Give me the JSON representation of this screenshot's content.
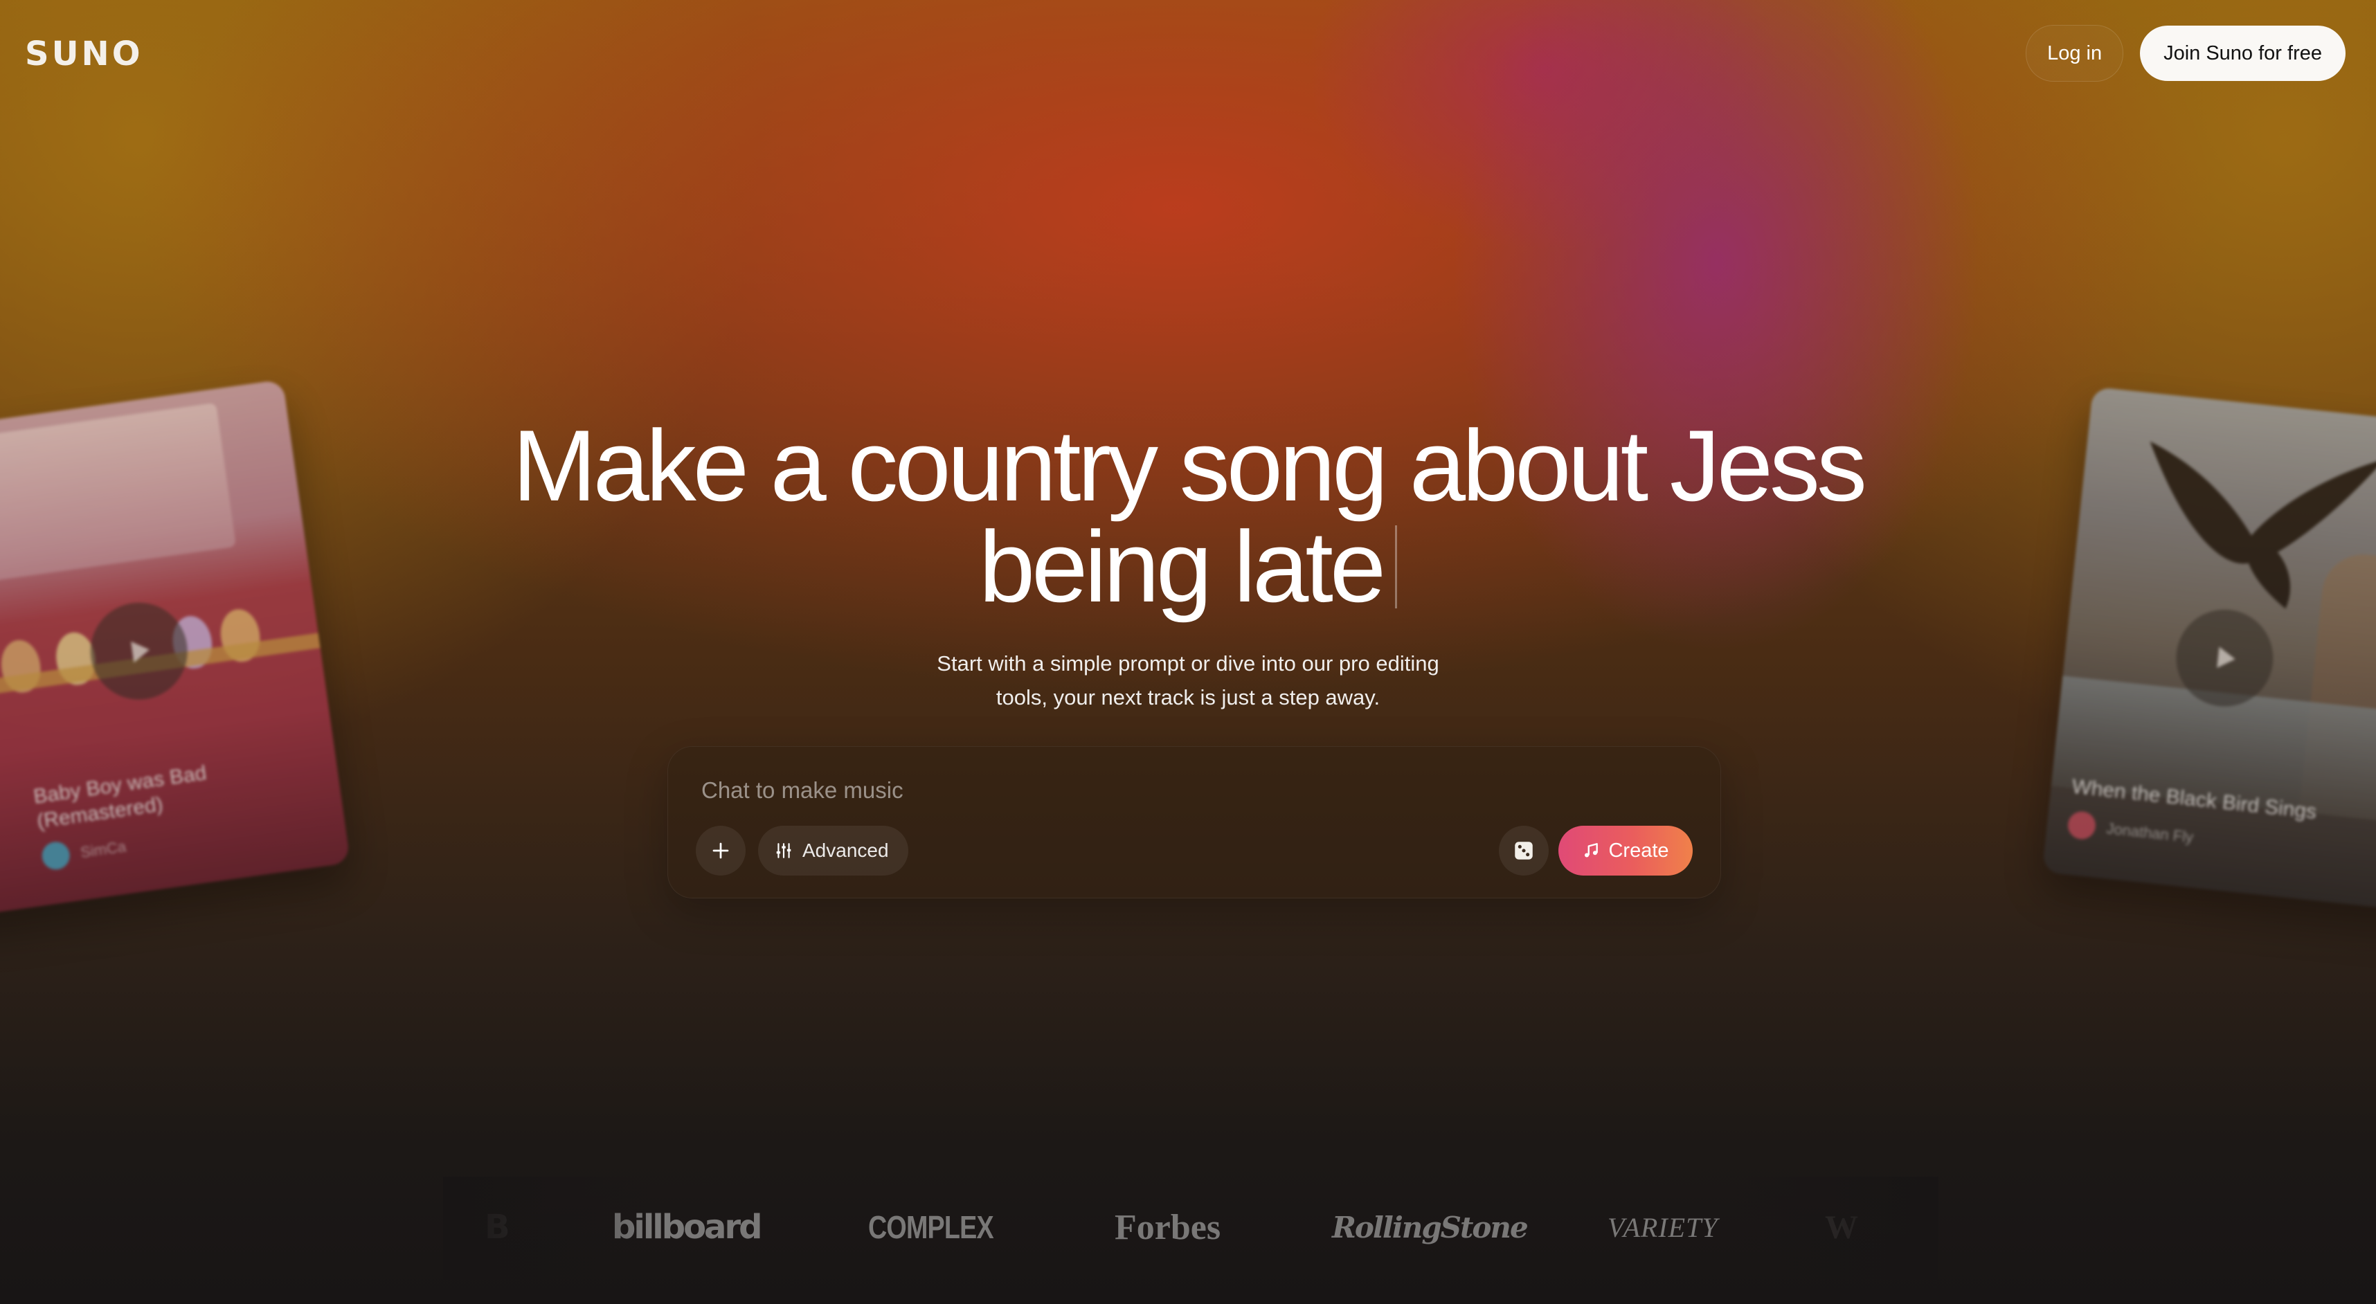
{
  "header": {
    "logo_text": "SUNO",
    "login_label": "Log in",
    "join_label": "Join Suno for free"
  },
  "hero": {
    "title_line1": "Make a country song about Jess",
    "title_line2": "being late",
    "subtitle_line1": "Start with a simple prompt or dive into our pro editing",
    "subtitle_line2": "tools, your next track is just a step away."
  },
  "composer": {
    "placeholder": "Chat to make music",
    "advanced_label": "Advanced",
    "create_label": "Create",
    "icons": {
      "add": "plus-icon",
      "advanced": "sliders-icon",
      "random": "dice-icon",
      "create": "music-note-icon"
    },
    "create_gradient": [
      "#e04a76",
      "#f0814a"
    ]
  },
  "cards": {
    "left": {
      "title_line1": "Baby Boy was Bad",
      "title_line2": "(Remastered)",
      "artist": "SimCa"
    },
    "right": {
      "title": "When the Black Bird Sings",
      "artist": "Jonathan Fly"
    }
  },
  "press": {
    "billboard": "billboard",
    "complex": "COMPLEX",
    "forbes": "Forbes",
    "rollingstone": "RollingStone",
    "variety": "VARIETY"
  }
}
